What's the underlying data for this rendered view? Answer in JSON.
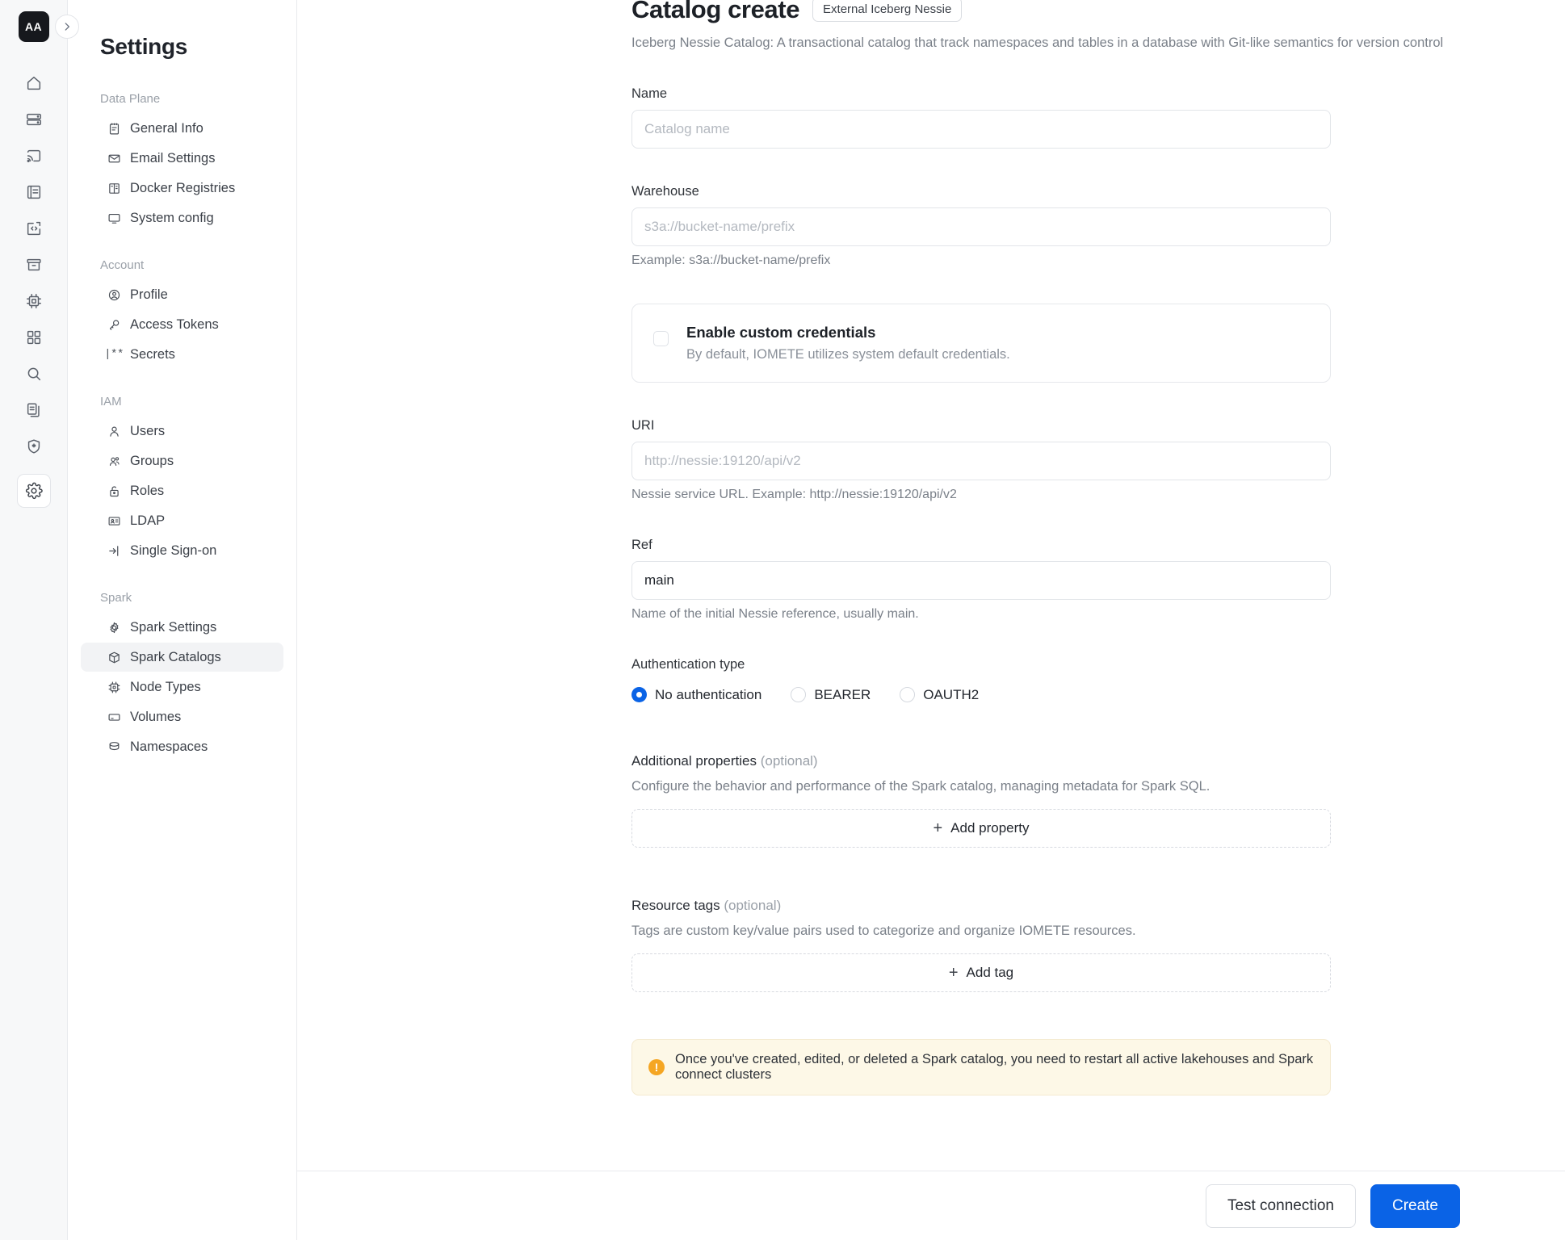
{
  "rail": {
    "avatar_initials": "AA",
    "expand_icon": "chevron-right-icon",
    "items": [
      {
        "icon": "home-icon",
        "name": "home"
      },
      {
        "icon": "database-icon",
        "name": "lakehouses"
      },
      {
        "icon": "cast-icon",
        "name": "streaming"
      },
      {
        "icon": "notebook-icon",
        "name": "notebooks"
      },
      {
        "icon": "code-icon",
        "name": "sql-editor"
      },
      {
        "icon": "archive-icon",
        "name": "jobs"
      },
      {
        "icon": "chip-icon",
        "name": "clusters"
      },
      {
        "icon": "grid-icon",
        "name": "apps"
      },
      {
        "icon": "search-icon",
        "name": "search"
      },
      {
        "icon": "documents-icon",
        "name": "documents"
      },
      {
        "icon": "shield-star-icon",
        "name": "security"
      },
      {
        "icon": "gear-icon",
        "name": "settings",
        "active": true
      }
    ]
  },
  "sidebar": {
    "title": "Settings",
    "groups": [
      {
        "label": "Data Plane",
        "items": [
          {
            "label": "General Info",
            "icon": "note-icon"
          },
          {
            "label": "Email Settings",
            "icon": "envelope-icon"
          },
          {
            "label": "Docker Registries",
            "icon": "registry-icon"
          },
          {
            "label": "System config",
            "icon": "monitor-icon"
          }
        ]
      },
      {
        "label": "Account",
        "items": [
          {
            "label": "Profile",
            "icon": "user-circle-icon"
          },
          {
            "label": "Access Tokens",
            "icon": "key-icon"
          },
          {
            "label": "Secrets",
            "icon": "secrets-icon"
          }
        ]
      },
      {
        "label": "IAM",
        "items": [
          {
            "label": "Users",
            "icon": "user-icon"
          },
          {
            "label": "Groups",
            "icon": "users-icon"
          },
          {
            "label": "Roles",
            "icon": "lock-icon"
          },
          {
            "label": "LDAP",
            "icon": "id-card-icon"
          },
          {
            "label": "Single Sign-on",
            "icon": "login-arrow-icon"
          }
        ]
      },
      {
        "label": "Spark",
        "items": [
          {
            "label": "Spark Settings",
            "icon": "gear-icon"
          },
          {
            "label": "Spark Catalogs",
            "icon": "cube-icon",
            "active": true
          },
          {
            "label": "Node Types",
            "icon": "chip-icon"
          },
          {
            "label": "Volumes",
            "icon": "volume-icon"
          },
          {
            "label": "Namespaces",
            "icon": "db-icon"
          }
        ]
      }
    ]
  },
  "page": {
    "title": "Catalog create",
    "badge": "External Iceberg Nessie",
    "description": "Iceberg Nessie Catalog: A transactional catalog that track namespaces and tables in a database with Git-like semantics for version control"
  },
  "form": {
    "name": {
      "label": "Name",
      "value": "",
      "placeholder": "Catalog name"
    },
    "warehouse": {
      "label": "Warehouse",
      "value": "",
      "placeholder": "s3a://bucket-name/prefix",
      "help": "Example: s3a://bucket-name/prefix"
    },
    "credentials": {
      "title": "Enable custom credentials",
      "subtitle": "By default, IOMETE utilizes system default credentials.",
      "checked": false
    },
    "uri": {
      "label": "URI",
      "value": "",
      "placeholder": "http://nessie:19120/api/v2",
      "help": "Nessie service URL. Example: http://nessie:19120/api/v2"
    },
    "ref": {
      "label": "Ref",
      "value": "main",
      "placeholder": "main",
      "help": "Name of the initial Nessie reference, usually main."
    },
    "auth": {
      "label": "Authentication type",
      "selected": "No authentication",
      "options": [
        {
          "label": "No authentication",
          "checked": true
        },
        {
          "label": "BEARER",
          "checked": false
        },
        {
          "label": "OAUTH2",
          "checked": false
        }
      ]
    },
    "additional_properties": {
      "title": "Additional properties",
      "optional": "(optional)",
      "description": "Configure the behavior and performance of the Spark catalog, managing metadata for Spark SQL.",
      "add_label": "Add property"
    },
    "resource_tags": {
      "title": "Resource tags",
      "optional": "(optional)",
      "description": "Tags are custom key/value pairs used to categorize and organize IOMETE resources.",
      "add_label": "Add tag"
    },
    "warning": {
      "icon": "warning-icon",
      "text": "Once you've created, edited, or deleted a Spark catalog, you need to restart all active lakehouses and Spark connect clusters"
    }
  },
  "footer": {
    "test_label": "Test connection",
    "create_label": "Create"
  },
  "colors": {
    "accent": "#0a63e6",
    "warning_bg": "#fdf8e7",
    "warning_icon": "#f5a623",
    "text": "#20242b",
    "muted": "#7a8089"
  }
}
